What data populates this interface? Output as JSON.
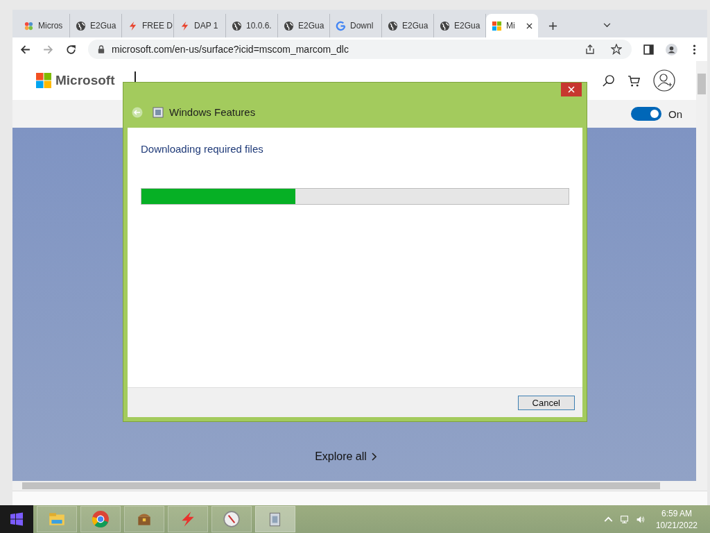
{
  "browser": {
    "tabs": [
      {
        "title": "Micros",
        "kind": "flower",
        "selected": false
      },
      {
        "title": "E2Gua",
        "kind": "globe",
        "selected": false
      },
      {
        "title": "FREE D",
        "kind": "bolt",
        "selected": false
      },
      {
        "title": "DAP 1",
        "kind": "bolt",
        "selected": false
      },
      {
        "title": "10.0.6.",
        "kind": "globe",
        "selected": false
      },
      {
        "title": "E2Gua",
        "kind": "globe",
        "selected": false
      },
      {
        "title": "Downl",
        "kind": "google",
        "selected": false
      },
      {
        "title": "E2Gua",
        "kind": "globe",
        "selected": false
      },
      {
        "title": "E2Gua",
        "kind": "globe",
        "selected": false
      },
      {
        "title": "Mi",
        "kind": "windows",
        "selected": true
      }
    ],
    "url": "microsoft.com/en-us/surface?icid=mscom_marcom_dlc"
  },
  "page": {
    "logo": "Microsoft",
    "toggle": {
      "on": true,
      "label": "On"
    },
    "explore": "Explore all"
  },
  "dialog": {
    "title": "Windows Features",
    "status": "Downloading required files",
    "level": 0.36,
    "cancel": "Cancel"
  },
  "taskbar": {
    "time": "6:59 AM",
    "date": "10/21/2022"
  }
}
